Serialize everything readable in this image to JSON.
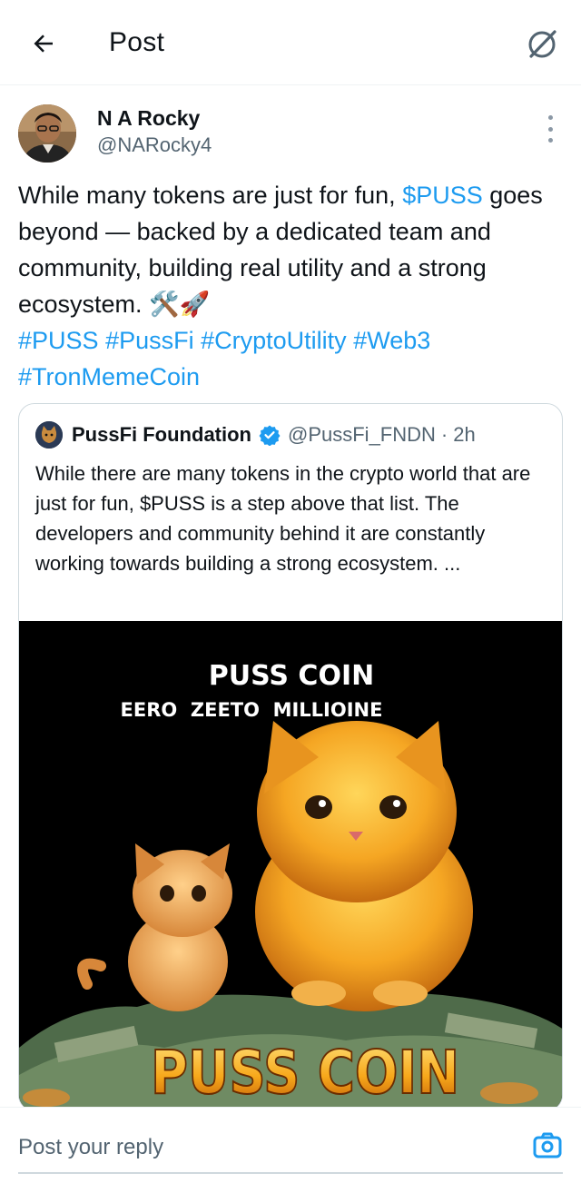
{
  "header": {
    "title": "Post"
  },
  "post": {
    "author_name": "N A Rocky",
    "author_handle": "@NARocky4",
    "text": {
      "part1": "While many tokens are just for fun, ",
      "cashtag": "$PUSS",
      "part2": " goes beyond — backed by a dedicated team and community, building real utility and a strong ecosystem. 🛠️🚀",
      "hashtags": [
        "#PUSS",
        "#PussFi",
        "#CryptoUtility",
        "#Web3",
        "#TronMemeCoin"
      ]
    }
  },
  "quote": {
    "name": "PussFi Foundation",
    "handle": "@PussFi_FNDN",
    "separator": "·",
    "time": "2h",
    "text": "While there are many tokens in the crypto world that are just for fun, $PUSS is a step above that list. The developers and community behind it are constantly working towards building a strong ecosystem. ...",
    "image": {
      "title": "PUSS COIN",
      "subtitle": "EERO  ZEETO  MILLIOINE",
      "bottom_text": "PUSS COIN"
    }
  },
  "reply": {
    "placeholder": "Post your reply"
  },
  "colors": {
    "accent": "#1d9bf0",
    "text_primary": "#0f1419",
    "text_secondary": "#536471"
  },
  "icons": {
    "back": "arrow-left-icon",
    "grok": "grok-icon",
    "more": "more-vertical-icon",
    "verified": "verified-badge-icon",
    "camera": "camera-icon"
  }
}
